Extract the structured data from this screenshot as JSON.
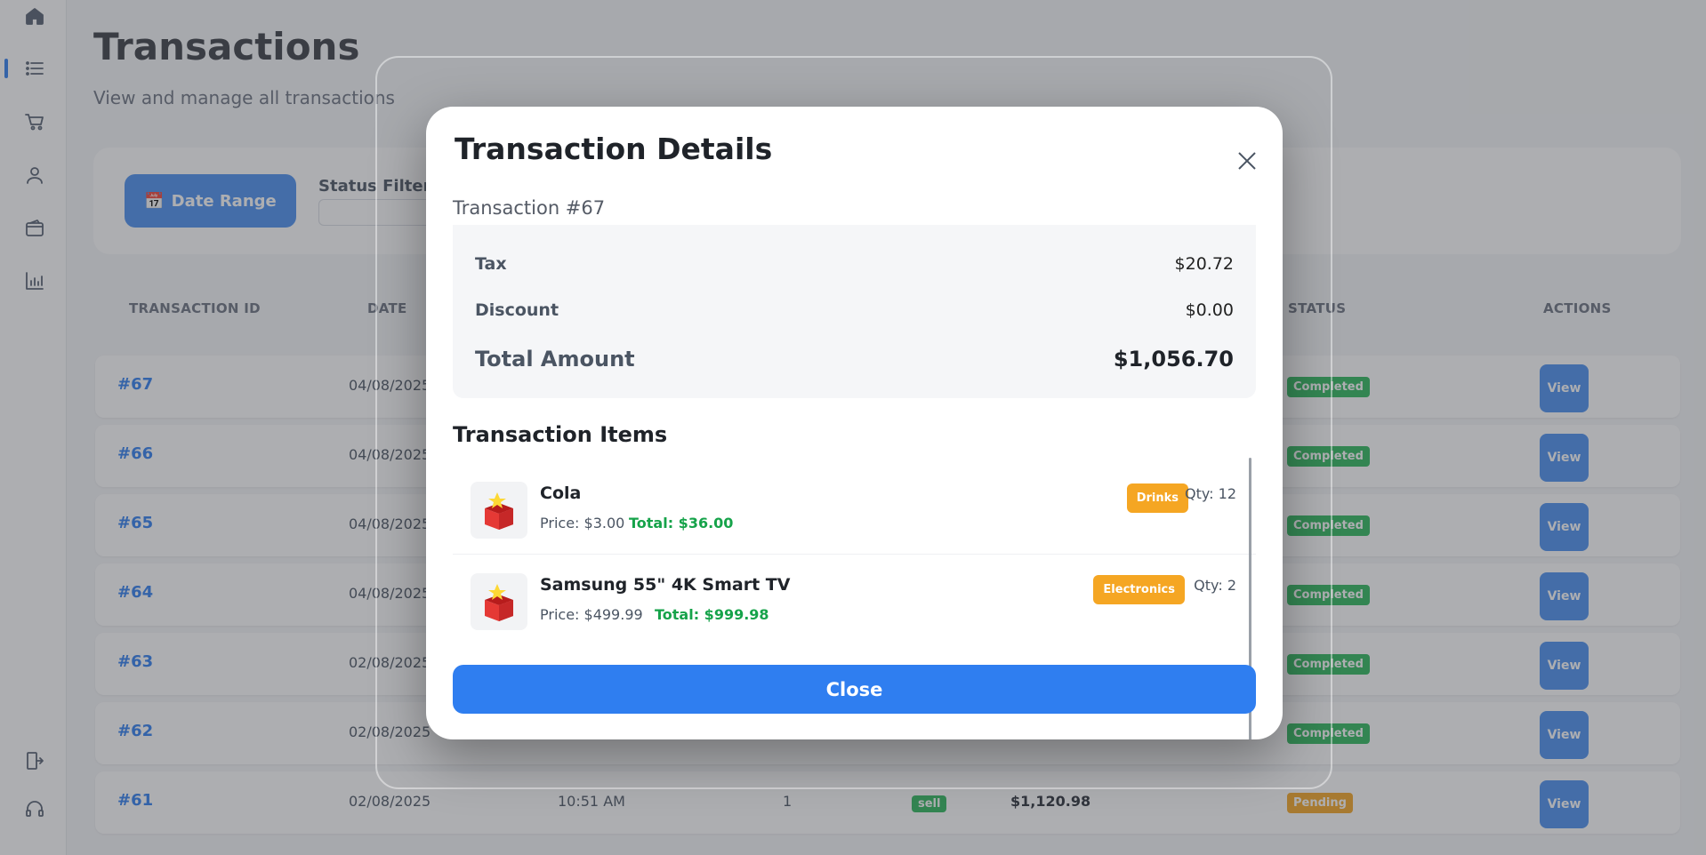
{
  "page": {
    "title": "Transactions",
    "subtitle": "View and manage all transactions"
  },
  "filters": {
    "date_range_label": "Date Range",
    "status_filter_label": "Status Filter"
  },
  "table": {
    "headers": {
      "transaction_id": "TRANSACTION ID",
      "date": "DATE",
      "status": "STATUS",
      "actions": "ACTIONS"
    },
    "rows": [
      {
        "id": "#67",
        "date": "04/08/2025",
        "time": "",
        "qty": "",
        "type": "",
        "amount": "",
        "status": "Completed",
        "action": "View"
      },
      {
        "id": "#66",
        "date": "04/08/2025",
        "time": "",
        "qty": "",
        "type": "",
        "amount": "",
        "status": "Completed",
        "action": "View"
      },
      {
        "id": "#65",
        "date": "04/08/2025",
        "time": "",
        "qty": "",
        "type": "",
        "amount": "",
        "status": "Completed",
        "action": "View"
      },
      {
        "id": "#64",
        "date": "04/08/2025",
        "time": "",
        "qty": "",
        "type": "",
        "amount": "",
        "status": "Completed",
        "action": "View"
      },
      {
        "id": "#63",
        "date": "02/08/2025",
        "time": "",
        "qty": "",
        "type": "",
        "amount": "",
        "status": "Completed",
        "action": "View"
      },
      {
        "id": "#62",
        "date": "02/08/2025",
        "time": "",
        "qty": "",
        "type": "",
        "amount": "",
        "status": "Completed",
        "action": "View"
      },
      {
        "id": "#61",
        "date": "02/08/2025",
        "time": "10:51 AM",
        "qty": "1",
        "type": "sell",
        "amount": "$1,120.98",
        "status": "Pending",
        "action": "View"
      }
    ]
  },
  "modal": {
    "title": "Transaction Details",
    "subtitle": "Transaction #67",
    "summary": {
      "tax_label": "Tax",
      "tax_value": "$20.72",
      "discount_label": "Discount",
      "discount_value": "$0.00",
      "total_label": "Total Amount",
      "total_value": "$1,056.70"
    },
    "items_title": "Transaction Items",
    "items": [
      {
        "name": "Cola",
        "price": "Price: $3.00",
        "total": "Total: $36.00",
        "category": "Drinks",
        "qty": "Qty: 12"
      },
      {
        "name": "Samsung 55\" 4K Smart TV",
        "price": "Price: $499.99",
        "total": "Total: $999.98",
        "category": "Electronics",
        "qty": "Qty: 2"
      }
    ],
    "close_label": "Close"
  },
  "colors": {
    "primary": "#2f7ef0",
    "success": "#2eb85c",
    "warning": "#f5a623",
    "total_green": "#16a34a"
  },
  "icons": {
    "sidebar": [
      "home-icon",
      "list-icon",
      "cart-icon",
      "user-icon",
      "wallet-icon",
      "chart-icon",
      "logout-icon",
      "headset-icon"
    ]
  }
}
